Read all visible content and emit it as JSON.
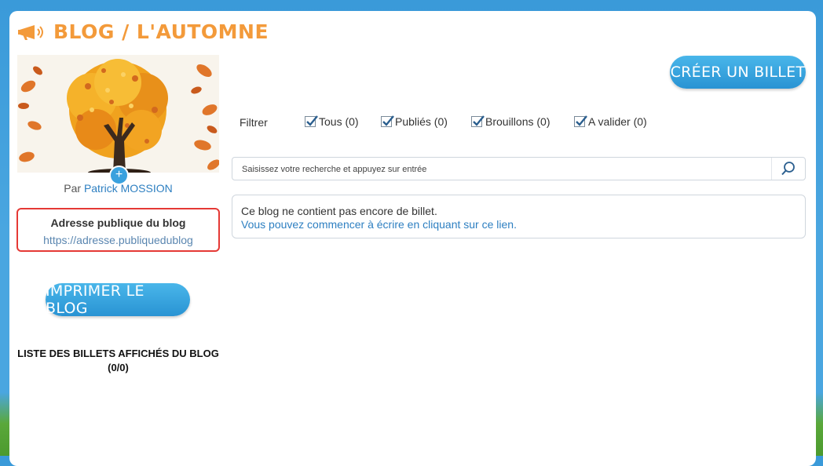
{
  "header": {
    "title": "BLOG / L'AUTOMNE",
    "icon": "megaphone-icon"
  },
  "sidebar": {
    "add_cover_label": "+",
    "author_prefix": "Par",
    "author_name": "Patrick MOSSION",
    "public_address_title": "Adresse publique du blog",
    "public_address_url": "https://adresse.publiquedublog",
    "print_button": "IMPRIMER LE BLOG",
    "posts_list_title": "LISTE DES BILLETS AFFICHÉS DU BLOG (0/0)"
  },
  "main": {
    "create_button": "CRÉER UN BILLET",
    "filter_label": "Filtrer",
    "filters": [
      {
        "label": "Tous (0)",
        "checked": true
      },
      {
        "label": "Publiés (0)",
        "checked": true
      },
      {
        "label": "Brouillons (0)",
        "checked": true
      },
      {
        "label": "A valider (0)",
        "checked": true
      }
    ],
    "search": {
      "placeholder": "Saisissez votre recherche et appuyez sur entrée",
      "value": ""
    },
    "empty": {
      "message": "Ce blog ne contient pas encore de billet.",
      "link": "Vous pouvez commencer à écrire en cliquant sur ce lien."
    }
  },
  "colors": {
    "accent_orange": "#f39a3a",
    "button_blue": "#3aa1de",
    "link_blue": "#2d7fc1",
    "highlight_red": "#e53935"
  }
}
